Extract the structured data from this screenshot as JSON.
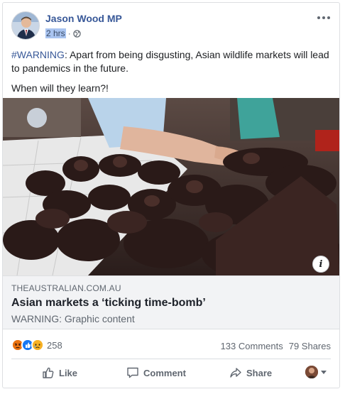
{
  "post": {
    "author": "Jason Wood MP",
    "time": "2 hrs",
    "time_separator": "·",
    "audience_icon": "globe-icon",
    "hashtag": "#WARNING",
    "body_line1": ": Apart from being disgusting, Asian wildlife markets will lead to pandemics in the future.",
    "body_line2": "When will they learn?!"
  },
  "link": {
    "domain": "THEAUSTRALIAN.COM.AU",
    "title": "Asian markets a ‘ticking time-bomb’",
    "description": "WARNING: Graphic content"
  },
  "stats": {
    "reaction_icons": [
      "angry-icon",
      "like-icon",
      "sad-icon"
    ],
    "reaction_count": "258",
    "comments": "133 Comments",
    "shares": "79 Shares"
  },
  "actions": {
    "like": "Like",
    "comment": "Comment",
    "share": "Share"
  },
  "colors": {
    "author": "#385898",
    "secondary_text": "#606770",
    "link_bg": "#f2f3f5",
    "like_blue": "#1877f2",
    "angry": "#e9710f",
    "sad_yellow": "#f7b125"
  }
}
